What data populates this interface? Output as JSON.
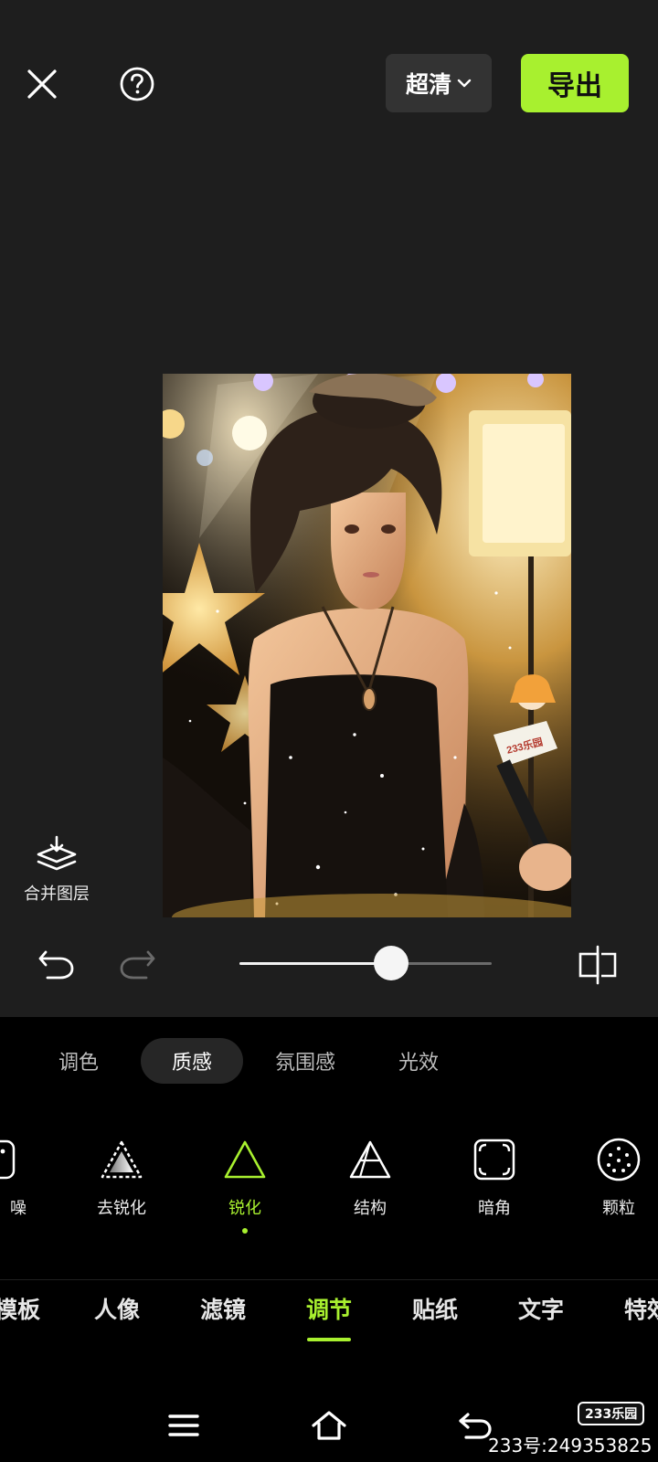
{
  "top_bar": {
    "quality_label": "超清",
    "export_label": "导出"
  },
  "canvas": {
    "merge_layers_label": "合并图层",
    "mic_label": "233乐园"
  },
  "adjust_slider": {
    "value": 0.6
  },
  "sub_tabs": [
    {
      "label": "调色",
      "active": false
    },
    {
      "label": "质感",
      "active": true
    },
    {
      "label": "氛围感",
      "active": false
    },
    {
      "label": "光效",
      "active": false
    }
  ],
  "tools": [
    {
      "label": "噪",
      "icon": "noise-icon",
      "active": false
    },
    {
      "label": "去锐化",
      "icon": "desharpen-icon",
      "active": false
    },
    {
      "label": "锐化",
      "icon": "sharpen-icon",
      "active": true
    },
    {
      "label": "结构",
      "icon": "structure-icon",
      "active": false
    },
    {
      "label": "暗角",
      "icon": "vignette-icon",
      "active": false
    },
    {
      "label": "颗粒",
      "icon": "grain-icon",
      "active": false
    }
  ],
  "main_tabs": [
    {
      "label": "模板",
      "active": false
    },
    {
      "label": "人像",
      "active": false
    },
    {
      "label": "滤镜",
      "active": false
    },
    {
      "label": "调节",
      "active": true
    },
    {
      "label": "贴纸",
      "active": false
    },
    {
      "label": "文字",
      "active": false
    },
    {
      "label": "特效",
      "active": false
    }
  ],
  "watermark": {
    "badge": "233乐园",
    "id_text": "233号:249353825"
  },
  "colors": {
    "accent": "#a8f02f",
    "editor_bg": "#1e1e1e",
    "panel_bg": "#000000"
  }
}
